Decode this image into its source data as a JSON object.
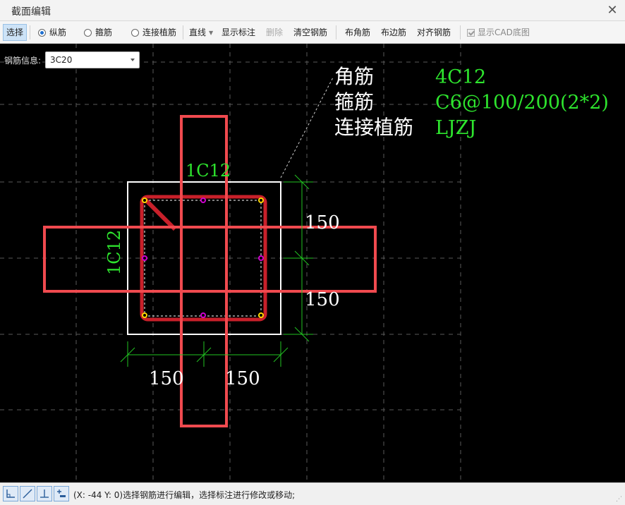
{
  "window": {
    "title": "截面编辑",
    "close_glyph": "✕"
  },
  "toolbar": {
    "select_label": "选择",
    "radio_longitudinal": "纵筋",
    "radio_stirrup": "箍筋",
    "radio_connection": "连接植筋",
    "selected_radio": "纵筋",
    "line_label": "直线",
    "show_annotation": "显示标注",
    "delete_label": "删除",
    "clear_rebar": "清空钢筋",
    "corner_rebar": "布角筋",
    "edge_rebar": "布边筋",
    "align_rebar": "对齐钢筋",
    "show_cad": "显示CAD底图",
    "show_cad_checked": true
  },
  "rebar_info": {
    "label": "钢筋信息:",
    "value": "3C20"
  },
  "drawing": {
    "legend": [
      {
        "name": "角筋",
        "value": "4C12"
      },
      {
        "name": "箍筋",
        "value": "C6@100/200(2*2)"
      },
      {
        "name": "连接植筋",
        "value": "LJZJ"
      }
    ],
    "top_edge_label": "1C12",
    "left_edge_label": "1C12",
    "dim_right_top": "150",
    "dim_right_bottom": "150",
    "dim_bottom_left": "150",
    "dim_bottom_right": "150",
    "colors": {
      "background": "#000000",
      "section_outline": "#ffffff",
      "stirrup": "#c8202a",
      "connection_band": "#f04a4f",
      "dimension": "#22c322",
      "annotation_green": "#2ee52e",
      "corner_bar": "#ffd800",
      "edge_bar": "#d000d0",
      "grid": "#5a5a5a"
    }
  },
  "statusbar": {
    "message": "(X: -44 Y: 0)选择钢筋进行编辑，选择标注进行修改或移动;",
    "tools": [
      "orthogonal-icon",
      "line-icon",
      "perpendicular-icon",
      "add-dimension-icon"
    ]
  }
}
